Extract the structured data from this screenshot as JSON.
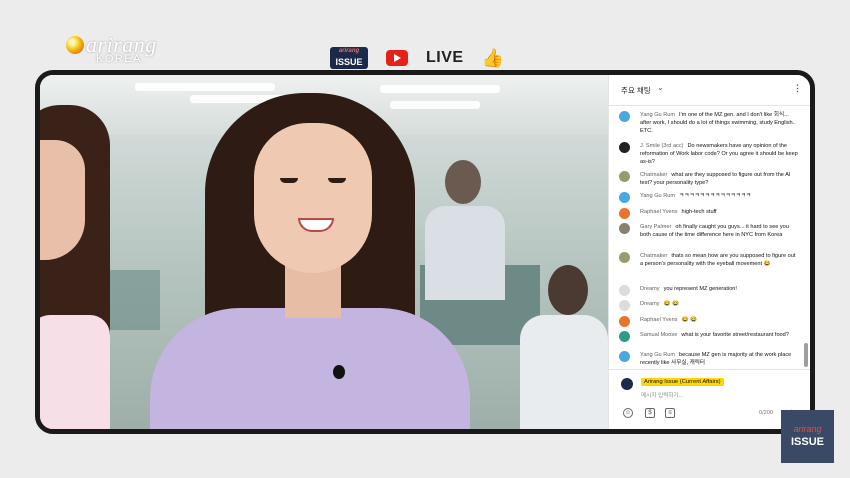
{
  "brand": {
    "name": "arirang",
    "sub": "KOREA"
  },
  "top_bar": {
    "issue_badge": "ISSUE",
    "issue_badge_small": "arirang",
    "live_label": "LIVE"
  },
  "chat": {
    "title": "주요 채팅",
    "more_icon": "more-vert-icon",
    "messages": [
      {
        "author": "Yang Gu Rum",
        "text": "I'm one of the MZ gen. and I don't like 회식... after work, I should do a lot of things swimming, study English.. ETC.",
        "avatar_color": "#4aa8e0"
      },
      {
        "author": "J. Smile (3rd acc)",
        "text": "Do newsmakers have any opinion of the reformation of Work labor code? Or you agree it should be keep as-is?",
        "avatar_color": "#222222"
      },
      {
        "author": "Chatmaker",
        "text": "what are they supposed to figure out from the AI test? your personality type?",
        "avatar_color": "#9a9a70"
      },
      {
        "author": "Yang Gu Rum",
        "text": "ㅋㅋㅋㅋㅋㅋㅋㅋㅋㅋㅋㅋㅋㅋ",
        "avatar_color": "#4aa8e0"
      },
      {
        "author": "Raphael Yvens",
        "text": "high-tech stuff",
        "avatar_color": "#e8742f"
      },
      {
        "author": "Gary Palmer",
        "text": "oh finally caught you guys... it hard to see you both cause of the time difference here in NYC from Korea",
        "avatar_color": "#8a8070"
      },
      {
        "author": "Chatmaker",
        "text": "thats so mean how are you supposed to figure out a person's personality with the eyeball movement 😂",
        "avatar_color": "#9a9a70"
      },
      {
        "author": "Dreamy",
        "text": "you represent MZ generation!",
        "avatar_color": "#dcdcdc"
      },
      {
        "author": "Dreamy",
        "text": "😂 😂",
        "avatar_color": "#dcdcdc"
      },
      {
        "author": "Raphael Yvens",
        "text": "😂 😂",
        "avatar_color": "#e8742f"
      },
      {
        "author": "Samual Moose",
        "text": "what is your favorite street/restaurant food?",
        "avatar_color": "#2e9c8a"
      },
      {
        "author": "Yang Gu Rum",
        "text": "because MZ gen is majority at the work place recently like 사무실, 캐릭터",
        "avatar_color": "#4aa8e0"
      }
    ],
    "input": {
      "channel_name": "Arirang Issue (Current Affairs)",
      "placeholder": "메시지 입력하기...",
      "count": "0/200"
    }
  },
  "corner_logo": {
    "brand": "arirang",
    "label": "ISSUE"
  },
  "colors": {
    "frame": "#1a1a1a",
    "highlight": "#ffd600",
    "live_red": "#e62117"
  }
}
